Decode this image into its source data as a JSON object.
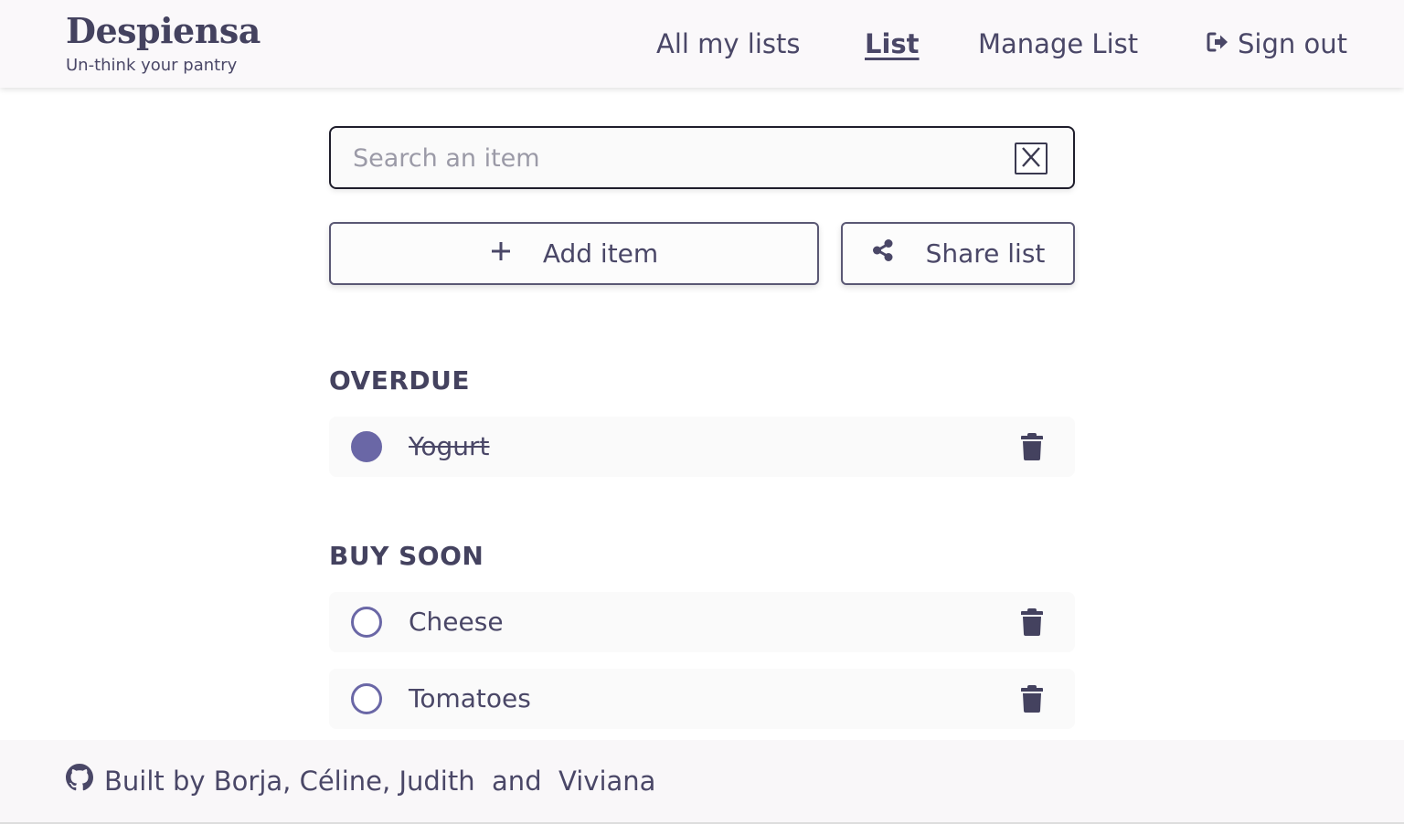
{
  "header": {
    "brand_name": "Despiensa",
    "tagline": "Un-think your pantry",
    "nav": {
      "all_lists": "All my lists",
      "list": "List",
      "manage_list": "Manage List",
      "sign_out": "Sign out"
    },
    "sign_out_icon": "sign-out-icon"
  },
  "search": {
    "placeholder": "Search an item",
    "value": "",
    "clear_icon": "close-icon"
  },
  "actions": {
    "add_item_label": "Add item",
    "add_item_icon": "plus-icon",
    "share_list_label": "Share list",
    "share_list_icon": "share-icon"
  },
  "sections": {
    "overdue": {
      "title": "OVERDUE",
      "items": [
        {
          "name": "Yogurt",
          "checked": true
        }
      ]
    },
    "buy_soon": {
      "title": "BUY SOON",
      "items": [
        {
          "name": "Cheese",
          "checked": false
        },
        {
          "name": "Tomatoes",
          "checked": false
        }
      ]
    }
  },
  "footer": {
    "text": "Built by Borja, Céline, Judith  and  Viviana",
    "icon": "github-icon"
  },
  "colors": {
    "text": "#4a4767",
    "accent": "#6a67a6",
    "header_bg": "#faf8fa",
    "row_bg": "#fafafa"
  }
}
